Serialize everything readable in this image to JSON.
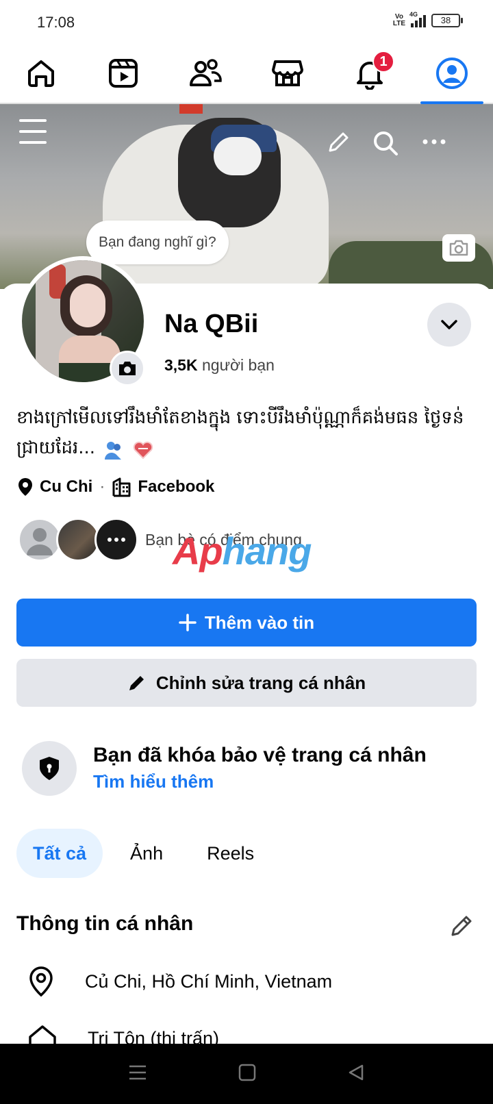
{
  "status_bar": {
    "time": "17:08",
    "volte_label": "Vo\nLTE",
    "network_type": "4G",
    "battery_level": "38"
  },
  "top_nav": {
    "items": [
      {
        "icon": "home-icon"
      },
      {
        "icon": "video-icon"
      },
      {
        "icon": "friends-icon"
      },
      {
        "icon": "marketplace-icon"
      },
      {
        "icon": "bell-icon",
        "badge": "1"
      },
      {
        "icon": "profile-icon",
        "active": true
      }
    ],
    "accent_color": "#1877f2",
    "badge_color": "#e41e3f"
  },
  "cover": {
    "thought_placeholder": "Bạn đang nghĩ gì?"
  },
  "profile": {
    "name": "Na QBii",
    "friend_count": "3,5K",
    "friend_label": "người bạn",
    "bio": "ខាងក្រៅមើលទៅរឹងមាំតែខាងក្នុង ទោះបីរឹងមាំប៉ុណ្ណាក៏គង់មធន ថ្ងៃទន់ជ្រាយដែរ...",
    "location": "Cu Chi",
    "workplace": "Facebook",
    "mutual_friends_text": "Bạn bè có điểm chung"
  },
  "watermark": {
    "part_a": "Ap",
    "part_b": "hang"
  },
  "actions": {
    "add_story_label": "Thêm vào tin",
    "edit_profile_label": "Chỉnh sửa trang cá nhân"
  },
  "profile_lock": {
    "title": "Bạn đã khóa bảo vệ trang cá nhân",
    "link": "Tìm hiểu thêm"
  },
  "tabs": [
    {
      "label": "Tất cả",
      "active": true
    },
    {
      "label": "Ảnh"
    },
    {
      "label": "Reels"
    }
  ],
  "personal_info": {
    "title": "Thông tin cá nhân",
    "rows": [
      {
        "icon": "location-pin-icon",
        "text": "Củ Chi, Hồ Chí Minh, Vietnam"
      },
      {
        "icon": "home-icon",
        "text": "Tri Tôn (thị trấn)"
      }
    ]
  }
}
